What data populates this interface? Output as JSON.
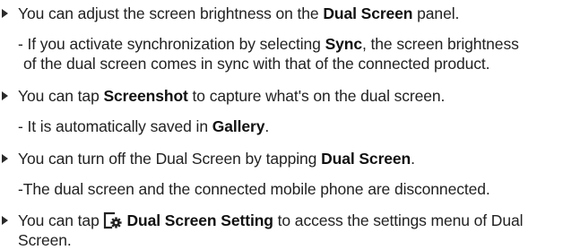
{
  "items": [
    {
      "main": {
        "pre": "You can adjust the screen brightness on the ",
        "bold": "Dual Screen",
        "post": " panel."
      },
      "sub": {
        "line1_pre": "- If you activate synchronization by selecting ",
        "line1_bold": "Sync",
        "line1_post": ", the screen brightness",
        "line2": "of the dual screen comes in sync with that of the connected product."
      }
    },
    {
      "main": {
        "pre": "You can tap ",
        "bold": "Screenshot",
        "post": " to capture what's on the dual screen."
      },
      "sub": {
        "pre": "- It is automatically saved in ",
        "bold": "Gallery",
        "post": "."
      }
    },
    {
      "main": {
        "pre": "You can turn off the Dual Screen by tapping ",
        "bold": "Dual Screen",
        "post": "."
      },
      "sub": {
        "text": "-The dual screen and the connected mobile phone are disconnected."
      }
    },
    {
      "main": {
        "pre": "You can tap ",
        "icon": "dual-screen-setting-gear-icon",
        "bold": "Dual Screen Setting",
        "post": " to access the settings menu of Dual",
        "line2": "Screen."
      }
    }
  ]
}
